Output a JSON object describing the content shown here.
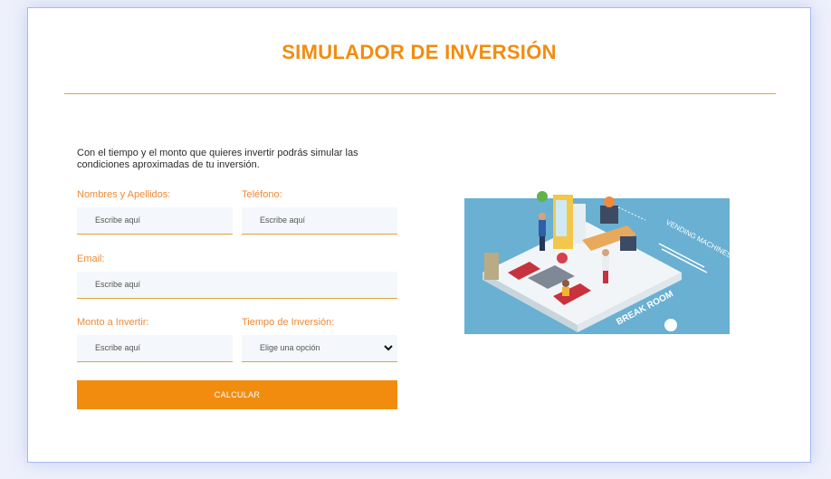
{
  "title": "SIMULADOR DE INVERSIÓN",
  "intro": "Con el tiempo y el monto que quieres invertir podrás simular las condiciones aproximadas de tu inversión.",
  "form": {
    "name_label": "Nombres y Apellidos:",
    "name_placeholder": "Escribe aquí",
    "phone_label": "Teléfono:",
    "phone_placeholder": "Escribe aquí",
    "email_label": "Email:",
    "email_placeholder": "Escribe aquí",
    "amount_label": "Monto a Invertir:",
    "amount_placeholder": "Escribe aquí",
    "time_label": "Tiempo de Inversión:",
    "time_selected": "Elige una opción",
    "submit_label": "CALCULAR"
  },
  "illustration": {
    "sign_text": "VENDING MACHINES",
    "room_text": "BREAK ROOM"
  },
  "colors": {
    "accent": "#f28c0f",
    "label": "#ef8a36",
    "sky": "#6ab0d2"
  }
}
